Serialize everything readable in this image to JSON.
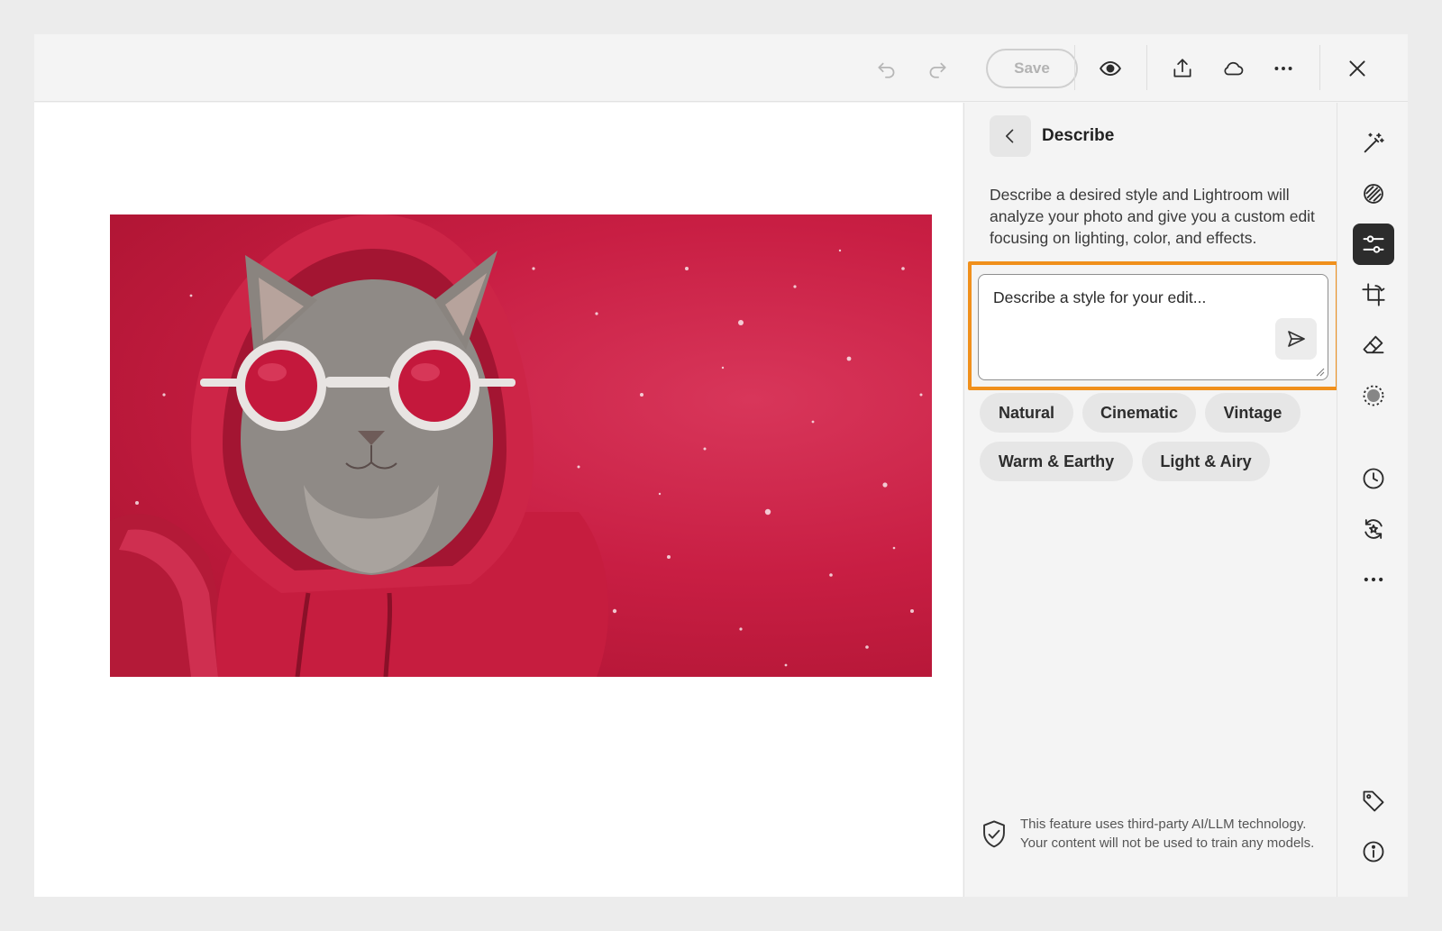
{
  "toolbar": {
    "save_label": "Save",
    "icons": [
      "undo-icon",
      "redo-icon",
      "eye-icon",
      "share-icon",
      "cloud-icon",
      "more-horizontal-icon",
      "close-icon"
    ]
  },
  "panel": {
    "title": "Describe",
    "description": "Describe a desired style and Lightroom will analyze your photo and give you a custom edit focusing on lighting, color, and effects.",
    "prompt": {
      "value": "",
      "placeholder": "Describe a style for your edit..."
    },
    "chips": [
      {
        "label": "Natural"
      },
      {
        "label": "Cinematic"
      },
      {
        "label": "Vintage"
      },
      {
        "label": "Warm & Earthy"
      },
      {
        "label": "Light & Airy"
      }
    ],
    "ai_note": {
      "line1": "This feature uses third-party AI/LLM technology.",
      "line2": "Your content will not be used to train any models."
    }
  },
  "rail": {
    "items": [
      {
        "icon": "magic-wand-icon",
        "active": false
      },
      {
        "icon": "presets-icon",
        "active": false
      },
      {
        "icon": "edit-sliders-icon",
        "active": true
      },
      {
        "icon": "crop-rotate-icon",
        "active": false
      },
      {
        "icon": "eraser-icon",
        "active": false
      },
      {
        "icon": "masking-icon",
        "active": false
      },
      {
        "icon": "history-icon",
        "active": false
      },
      {
        "icon": "versions-icon",
        "active": false
      },
      {
        "icon": "more-horizontal-icon",
        "active": false
      },
      {
        "icon": "tag-icon",
        "active": false
      },
      {
        "icon": "info-icon",
        "active": false
      }
    ]
  },
  "colors": {
    "accent_highlight": "#f0901c",
    "active_tool": "#2c2c2c",
    "photo_background": "#c81e43"
  }
}
